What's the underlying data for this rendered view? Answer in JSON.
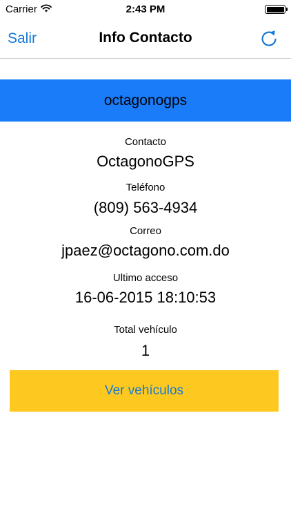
{
  "status_bar": {
    "carrier": "Carrier",
    "time": "2:43 PM",
    "battery_level": 1.0
  },
  "nav": {
    "back_label": "Salir",
    "title": "Info Contacto"
  },
  "banner": {
    "name": "octagonogps",
    "color": "#1a7cf9"
  },
  "fields": {
    "contacto": {
      "label": "Contacto",
      "value": "OctagonoGPS"
    },
    "telefono": {
      "label": "Teléfono",
      "value": "(809) 563-4934"
    },
    "correo": {
      "label": "Correo",
      "value": "jpaez@octagono.com.do"
    },
    "ultimo_acceso": {
      "label": "Ultimo acceso",
      "value": "16-06-2015 18:10:53"
    },
    "total_vehiculo": {
      "label": "Total vehículo",
      "value": "1"
    }
  },
  "action": {
    "ver_vehiculos_label": "Ver vehículos",
    "color": "#fdc81f"
  },
  "icons": {
    "refresh": "refresh-icon",
    "wifi": "wifi-icon",
    "battery": "battery-icon"
  }
}
